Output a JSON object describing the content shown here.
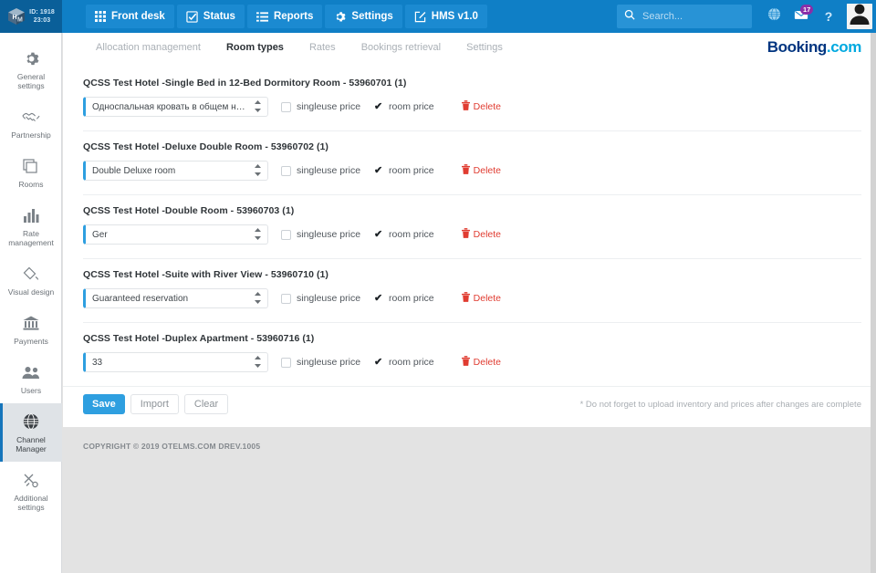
{
  "topbar": {
    "brand": {
      "icon": "cube-hm-logo",
      "id_line1": "ID: 1918",
      "id_line2": "23:03"
    },
    "nav": [
      {
        "label": "Front desk",
        "icon": "grid-icon"
      },
      {
        "label": "Status",
        "icon": "checked-square-icon"
      },
      {
        "label": "Reports",
        "icon": "list-icon"
      },
      {
        "label": "Settings",
        "icon": "gear-icon"
      },
      {
        "label": "HMS v1.0",
        "icon": "edit-square-icon"
      }
    ],
    "search": {
      "placeholder": "Search...",
      "value": "",
      "icon": "search-icon"
    },
    "globe_icon": "globe-icon",
    "messages": {
      "icon": "envelope-icon",
      "badge": "17"
    },
    "help": {
      "label": "?",
      "icon": "question-mark-icon"
    },
    "avatar": {
      "icon": "user-avatar"
    },
    "colors": {
      "bar": "#0f7fc6",
      "brand_block": "#0a5f99",
      "badge": "#8a2fa8"
    }
  },
  "sidebar": {
    "items": [
      {
        "label": "General settings",
        "icon": "gear-icon",
        "active": false
      },
      {
        "label": "Partnership",
        "icon": "handshake-icon",
        "active": false
      },
      {
        "label": "Rooms",
        "icon": "rooms-stack-icon",
        "active": false
      },
      {
        "label": "Rate management",
        "icon": "bar-chart-icon",
        "active": false
      },
      {
        "label": "Visual design",
        "icon": "diamond-brush-icon",
        "active": false
      },
      {
        "label": "Payments",
        "icon": "bank-icon",
        "active": false
      },
      {
        "label": "Users",
        "icon": "users-icon",
        "active": false
      },
      {
        "label": "Channel Manager",
        "icon": "globe-icon",
        "active": true
      },
      {
        "label": "Additional settings",
        "icon": "tools-icon",
        "active": false
      }
    ],
    "active_color": "#1675bb"
  },
  "tabs": [
    {
      "label": "Allocation management",
      "active": false
    },
    {
      "label": "Room types",
      "active": true
    },
    {
      "label": "Rates",
      "active": false
    },
    {
      "label": "Bookings retrieval",
      "active": false
    },
    {
      "label": "Settings",
      "active": false
    }
  ],
  "logo": {
    "part1": "Booking",
    "part2": ".com",
    "color1": "#003580",
    "color2": "#00a9e0"
  },
  "rows": [
    {
      "title": "QCSS Test Hotel -Single Bed in 12-Bed Dormitory Room - 53960701 (1)",
      "select_value": "Односпальная кровать в общем номере",
      "singleuse_label": "singleuse price",
      "singleuse_checked": false,
      "roomprice_label": "room price",
      "roomprice_checked": true,
      "delete_label": "Delete"
    },
    {
      "title": "QCSS Test Hotel -Deluxe Double Room - 53960702 (1)",
      "select_value": "Double Deluxe room",
      "singleuse_label": "singleuse price",
      "singleuse_checked": false,
      "roomprice_label": "room price",
      "roomprice_checked": true,
      "delete_label": "Delete"
    },
    {
      "title": "QCSS Test Hotel -Double Room - 53960703 (1)",
      "select_value": "Ger",
      "singleuse_label": "singleuse price",
      "singleuse_checked": false,
      "roomprice_label": "room price",
      "roomprice_checked": true,
      "delete_label": "Delete"
    },
    {
      "title": "QCSS Test Hotel -Suite with River View - 53960710 (1)",
      "select_value": "Guaranteed reservation",
      "singleuse_label": "singleuse price",
      "singleuse_checked": false,
      "roomprice_label": "room price",
      "roomprice_checked": true,
      "delete_label": "Delete"
    },
    {
      "title": "QCSS Test Hotel -Duplex Apartment - 53960716 (1)",
      "select_value": "33",
      "singleuse_label": "singleuse price",
      "singleuse_checked": false,
      "roomprice_label": "room price",
      "roomprice_checked": true,
      "delete_label": "Delete"
    }
  ],
  "actions": {
    "save": "Save",
    "import": "Import",
    "clear": "Clear",
    "note": "* Do not forget to upload inventory and prices after changes are complete"
  },
  "footer": {
    "copyright": "COPYRIGHT © 2019 OTELMS.COM DREV.1005"
  }
}
